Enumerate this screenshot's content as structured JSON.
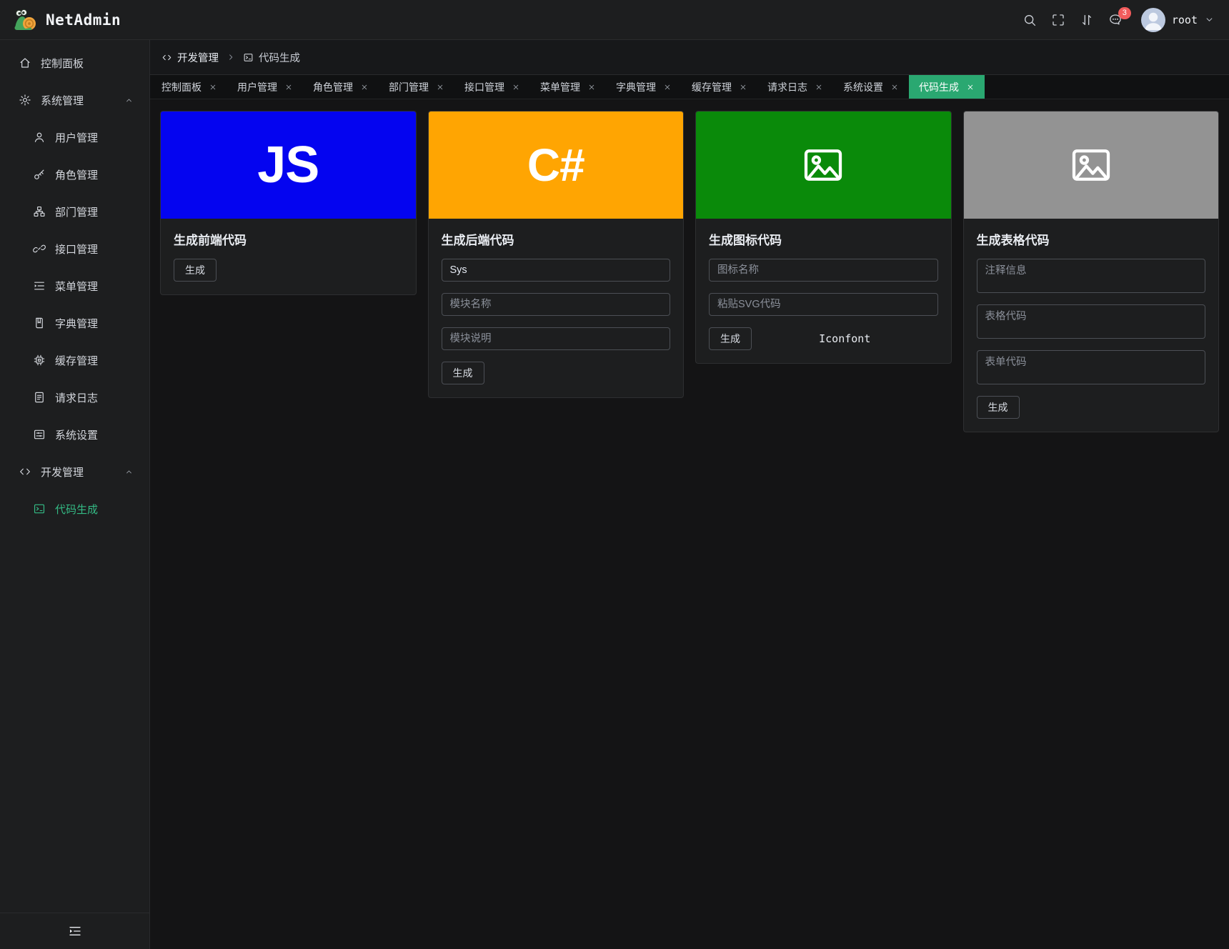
{
  "colors": {
    "accent": "#2aa871",
    "accent-light": "#34bb85",
    "panel-bg": "#1d1e1f",
    "content-bg": "#141415",
    "card-bg": "#1d1e1f",
    "border": "#2a2b2d",
    "input-border": "#4c4f55",
    "text": "#d3d6dc",
    "text-muted": "#8b909a",
    "js-blue": "#0404f0",
    "cs-orange": "#ffa502",
    "icon-green": "#0a8a0a",
    "table-gray": "#939393",
    "badge-red": "#f25c5c"
  },
  "app": {
    "name": "NetAdmin"
  },
  "header": {
    "icons": [
      "search-icon",
      "fullscreen-icon",
      "sort-icon",
      "chat-icon"
    ],
    "notification_count": "3",
    "user": {
      "name": "root"
    }
  },
  "sidebar": {
    "items": [
      {
        "label": "控制面板",
        "icon": "home-icon",
        "level": 1
      },
      {
        "label": "系统管理",
        "icon": "gear-icon",
        "level": 1,
        "arrow": "up"
      },
      {
        "label": "用户管理",
        "icon": "user-icon",
        "level": 2
      },
      {
        "label": "角色管理",
        "icon": "key-icon",
        "level": 2
      },
      {
        "label": "部门管理",
        "icon": "org-icon",
        "level": 2
      },
      {
        "label": "接口管理",
        "icon": "api-icon",
        "level": 2
      },
      {
        "label": "菜单管理",
        "icon": "menu-list-icon",
        "level": 2
      },
      {
        "label": "字典管理",
        "icon": "book-icon",
        "level": 2
      },
      {
        "label": "缓存管理",
        "icon": "cpu-icon",
        "level": 2
      },
      {
        "label": "请求日志",
        "icon": "log-icon",
        "level": 2
      },
      {
        "label": "系统设置",
        "icon": "settings-icon",
        "level": 2
      },
      {
        "label": "开发管理",
        "icon": "code-icon",
        "level": 1,
        "arrow": "up"
      },
      {
        "label": "代码生成",
        "icon": "terminal-icon",
        "level": 2,
        "active": true
      }
    ]
  },
  "breadcrumb": {
    "items": [
      {
        "label": "开发管理",
        "icon": "code-icon"
      },
      {
        "label": "代码生成",
        "icon": "terminal-icon"
      }
    ]
  },
  "tabs": [
    {
      "label": "控制面板"
    },
    {
      "label": "用户管理"
    },
    {
      "label": "角色管理"
    },
    {
      "label": "部门管理"
    },
    {
      "label": "接口管理"
    },
    {
      "label": "菜单管理"
    },
    {
      "label": "字典管理"
    },
    {
      "label": "缓存管理"
    },
    {
      "label": "请求日志"
    },
    {
      "label": "系统设置"
    },
    {
      "label": "代码生成",
      "active": true
    }
  ],
  "cards": {
    "frontend": {
      "title": "生成前端代码",
      "badge_text": "JS",
      "generate_label": "生成"
    },
    "backend": {
      "title": "生成后端代码",
      "badge_text": "C#",
      "fields": [
        {
          "value": "Sys"
        },
        {
          "placeholder": "模块名称"
        },
        {
          "placeholder": "模块说明"
        }
      ],
      "generate_label": "生成"
    },
    "icon": {
      "title": "生成图标代码",
      "fields": [
        {
          "placeholder": "图标名称"
        },
        {
          "placeholder": "粘贴SVG代码"
        }
      ],
      "generate_label": "生成",
      "link_label": "Iconfont"
    },
    "table": {
      "title": "生成表格代码",
      "fields": [
        {
          "placeholder": "注释信息"
        },
        {
          "placeholder": "表格代码"
        },
        {
          "placeholder": "表单代码"
        }
      ],
      "generate_label": "生成"
    }
  }
}
